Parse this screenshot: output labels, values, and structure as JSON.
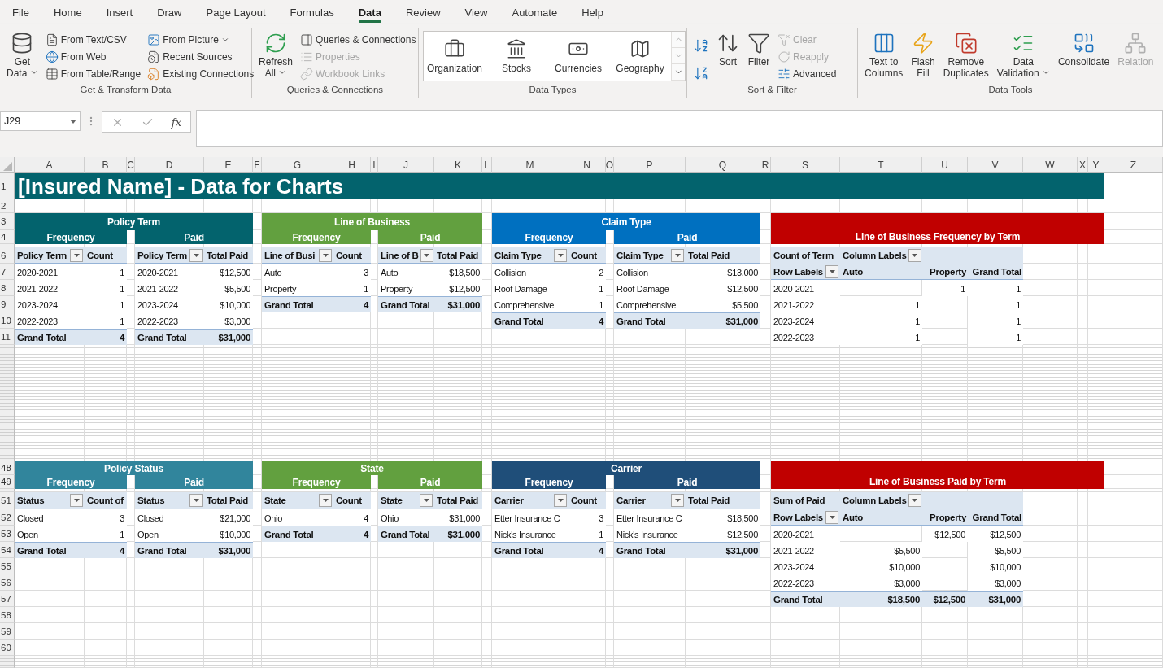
{
  "menu_tabs": [
    {
      "label": "File",
      "selected": false
    },
    {
      "label": "Home",
      "selected": false
    },
    {
      "label": "Insert",
      "selected": false
    },
    {
      "label": "Draw",
      "selected": false
    },
    {
      "label": "Page Layout",
      "selected": false
    },
    {
      "label": "Formulas",
      "selected": false
    },
    {
      "label": "Data",
      "selected": true
    },
    {
      "label": "Review",
      "selected": false
    },
    {
      "label": "View",
      "selected": false
    },
    {
      "label": "Automate",
      "selected": false
    },
    {
      "label": "Help",
      "selected": false
    }
  ],
  "ribbon": {
    "groups": [
      {
        "label": "Get & Transform Data",
        "items": [
          {
            "kind": "large",
            "label": "Get\nData",
            "dropdown": true,
            "disabled": false
          },
          {
            "kind": "stack",
            "items": [
              {
                "label": "From Text/CSV",
                "disabled": false
              },
              {
                "label": "From Web",
                "disabled": false
              },
              {
                "label": "From Table/Range",
                "disabled": false
              }
            ]
          },
          {
            "kind": "stack",
            "items": [
              {
                "label": "From Picture",
                "dropdown": true,
                "disabled": false
              },
              {
                "label": "Recent Sources",
                "disabled": false
              },
              {
                "label": "Existing Connections",
                "disabled": false
              }
            ]
          }
        ]
      },
      {
        "label": "Queries & Connections",
        "items": [
          {
            "kind": "large",
            "label": "Refresh\nAll",
            "dropdown": true,
            "disabled": false
          },
          {
            "kind": "stack",
            "items": [
              {
                "label": "Queries & Connections",
                "disabled": false
              },
              {
                "label": "Properties",
                "disabled": true
              },
              {
                "label": "Workbook Links",
                "disabled": true
              }
            ]
          }
        ]
      },
      {
        "label": "Data Types",
        "items": [
          {
            "kind": "gallery",
            "items": [
              {
                "label": "Organization"
              },
              {
                "label": "Stocks"
              },
              {
                "label": "Currencies"
              },
              {
                "label": "Geography"
              }
            ]
          }
        ]
      },
      {
        "label": "Sort & Filter",
        "items": [
          {
            "kind": "sort_buttons"
          },
          {
            "kind": "large",
            "label": "Sort",
            "disabled": false
          },
          {
            "kind": "large",
            "label": "Filter",
            "disabled": false
          },
          {
            "kind": "stack",
            "items": [
              {
                "label": "Clear",
                "disabled": true
              },
              {
                "label": "Reapply",
                "disabled": true
              },
              {
                "label": "Advanced",
                "disabled": false
              }
            ]
          }
        ]
      },
      {
        "label": "Data Tools",
        "items": [
          {
            "kind": "large",
            "label": "Text to\nColumns",
            "disabled": false
          },
          {
            "kind": "large",
            "label": "Flash\nFill",
            "disabled": false
          },
          {
            "kind": "large",
            "label": "Remove\nDuplicates",
            "disabled": false
          },
          {
            "kind": "large",
            "label": "Data\nValidation",
            "dropdown": true,
            "disabled": false
          },
          {
            "kind": "large",
            "label": "Consolidate",
            "disabled": false
          },
          {
            "kind": "large",
            "label": "Relation",
            "disabled": true
          }
        ]
      }
    ]
  },
  "formula_bar": {
    "name_box": "J29",
    "function_label": "fx"
  },
  "sheet": {
    "column_letters": [
      "A",
      "B",
      "C",
      "D",
      "E",
      "F",
      "G",
      "H",
      "I",
      "J",
      "K",
      "L",
      "M",
      "N",
      "O",
      "P",
      "Q",
      "R",
      "S",
      "T",
      "U",
      "V",
      "W",
      "X",
      "Y",
      "Z"
    ],
    "row_numbers": [
      "1",
      "2",
      "3",
      "4",
      "6",
      "7",
      "8",
      "9",
      "10",
      "11",
      "48",
      "49",
      "51",
      "52",
      "53",
      "54",
      "55",
      "56",
      "57",
      "58",
      "59",
      "60"
    ],
    "title": "[Insured Name] - Data for Charts",
    "panels": [
      {
        "kind": "split",
        "title": "Policy Term",
        "color": "#03636d",
        "frequency": {
          "label": "Frequency",
          "headers": [
            "Policy Term",
            "Count"
          ],
          "rows": [
            [
              "2020-2021",
              "1"
            ],
            [
              "2021-2022",
              "1"
            ],
            [
              "2023-2024",
              "1"
            ],
            [
              "2022-2023",
              "1"
            ]
          ],
          "total": [
            "Grand Total",
            "4"
          ]
        },
        "paid": {
          "label": "Paid",
          "headers": [
            "Policy Term",
            "Total Paid"
          ],
          "rows": [
            [
              "2020-2021",
              "$12,500"
            ],
            [
              "2021-2022",
              "$5,500"
            ],
            [
              "2023-2024",
              "$10,000"
            ],
            [
              "2022-2023",
              "$3,000"
            ]
          ],
          "total": [
            "Grand Total",
            "$31,000"
          ]
        }
      },
      {
        "kind": "split",
        "title": "Line of Business",
        "color": "#62a03f",
        "frequency": {
          "label": "Frequency",
          "headers": [
            "Line of Busi",
            "Count"
          ],
          "rows": [
            [
              "Auto",
              "3"
            ],
            [
              "Property",
              "1"
            ]
          ],
          "total": [
            "Grand Total",
            "4"
          ]
        },
        "paid": {
          "label": "Paid",
          "headers": [
            "Line of B",
            "Total Paid"
          ],
          "rows": [
            [
              "Auto",
              "$18,500"
            ],
            [
              "Property",
              "$12,500"
            ]
          ],
          "total": [
            "Grand Total",
            "$31,000"
          ]
        }
      },
      {
        "kind": "split",
        "title": "Claim Type",
        "color": "#0070c0",
        "frequency": {
          "label": "Frequency",
          "headers": [
            "Claim Type",
            "Count"
          ],
          "rows": [
            [
              "Collision",
              "2"
            ],
            [
              "Roof Damage",
              "1"
            ],
            [
              "Comprehensive",
              "1"
            ]
          ],
          "total": [
            "Grand Total",
            "4"
          ]
        },
        "paid": {
          "label": "Paid",
          "headers": [
            "Claim Type",
            "Total Paid"
          ],
          "rows": [
            [
              "Collision",
              "$13,000"
            ],
            [
              "Roof Damage",
              "$12,500"
            ],
            [
              "Comprehensive",
              "$5,500"
            ]
          ],
          "total": [
            "Grand Total",
            "$31,000"
          ]
        }
      },
      {
        "kind": "cross",
        "title": "Line of Business Frequency by Term",
        "color": "#c00000",
        "corner": "Count of Term",
        "column_labels": "Column Labels",
        "columns": [
          "Row Labels",
          "Auto",
          "Property",
          "Grand Total"
        ],
        "rows": [
          [
            "2020-2021",
            null,
            "1",
            "1"
          ],
          [
            "2021-2022",
            "1",
            null,
            "1"
          ],
          [
            "2023-2024",
            "1",
            null,
            "1"
          ],
          [
            "2022-2023",
            "1",
            null,
            "1"
          ]
        ]
      },
      {
        "kind": "split",
        "title": "Policy Status",
        "color": "#31859c",
        "frequency": {
          "label": "Frequency",
          "headers": [
            "Status",
            "Count of"
          ],
          "rows": [
            [
              "Closed",
              "3"
            ],
            [
              "Open",
              "1"
            ]
          ],
          "total": [
            "Grand Total",
            "4"
          ]
        },
        "paid": {
          "label": "Paid",
          "headers": [
            "Status",
            "Total Paid"
          ],
          "rows": [
            [
              "Closed",
              "$21,000"
            ],
            [
              "Open",
              "$10,000"
            ]
          ],
          "total": [
            "Grand Total",
            "$31,000"
          ]
        }
      },
      {
        "kind": "split",
        "title": "State",
        "color": "#62a03f",
        "frequency": {
          "label": "Frequency",
          "headers": [
            "State",
            "Count"
          ],
          "rows": [
            [
              "Ohio",
              "4"
            ]
          ],
          "total": [
            "Grand Total",
            "4"
          ]
        },
        "paid": {
          "label": "Paid",
          "headers": [
            "State",
            "Total Paid"
          ],
          "rows": [
            [
              "Ohio",
              "$31,000"
            ]
          ],
          "total": [
            "Grand Total",
            "$31,000"
          ]
        }
      },
      {
        "kind": "split",
        "title": "Carrier",
        "color": "#1f4e79",
        "frequency": {
          "label": "Frequency",
          "headers": [
            "Carrier",
            "Count"
          ],
          "rows": [
            [
              "Etter Insurance C",
              "3"
            ],
            [
              "Nick's Insurance",
              "1"
            ]
          ],
          "total": [
            "Grand Total",
            "4"
          ]
        },
        "paid": {
          "label": "Paid",
          "headers": [
            "Carrier",
            "Total Paid"
          ],
          "rows": [
            [
              "Etter Insurance C",
              "$18,500"
            ],
            [
              "Nick's Insurance",
              "$12,500"
            ]
          ],
          "total": [
            "Grand Total",
            "$31,000"
          ]
        }
      },
      {
        "kind": "cross",
        "title": "Line of Business Paid by Term",
        "color": "#c00000",
        "corner": "Sum of Paid",
        "column_labels": "Column Labels",
        "columns": [
          "Row Labels",
          "Auto",
          "Property",
          "Grand Total"
        ],
        "rows": [
          [
            "2020-2021",
            null,
            "$12,500",
            "$12,500"
          ],
          [
            "2021-2022",
            "$5,500",
            null,
            "$5,500"
          ],
          [
            "2023-2024",
            "$10,000",
            null,
            "$10,000"
          ],
          [
            "2022-2023",
            "$3,000",
            null,
            "$3,000"
          ]
        ],
        "total": [
          "Grand Total",
          "$18,500",
          "$12,500",
          "$31,000"
        ]
      }
    ]
  }
}
